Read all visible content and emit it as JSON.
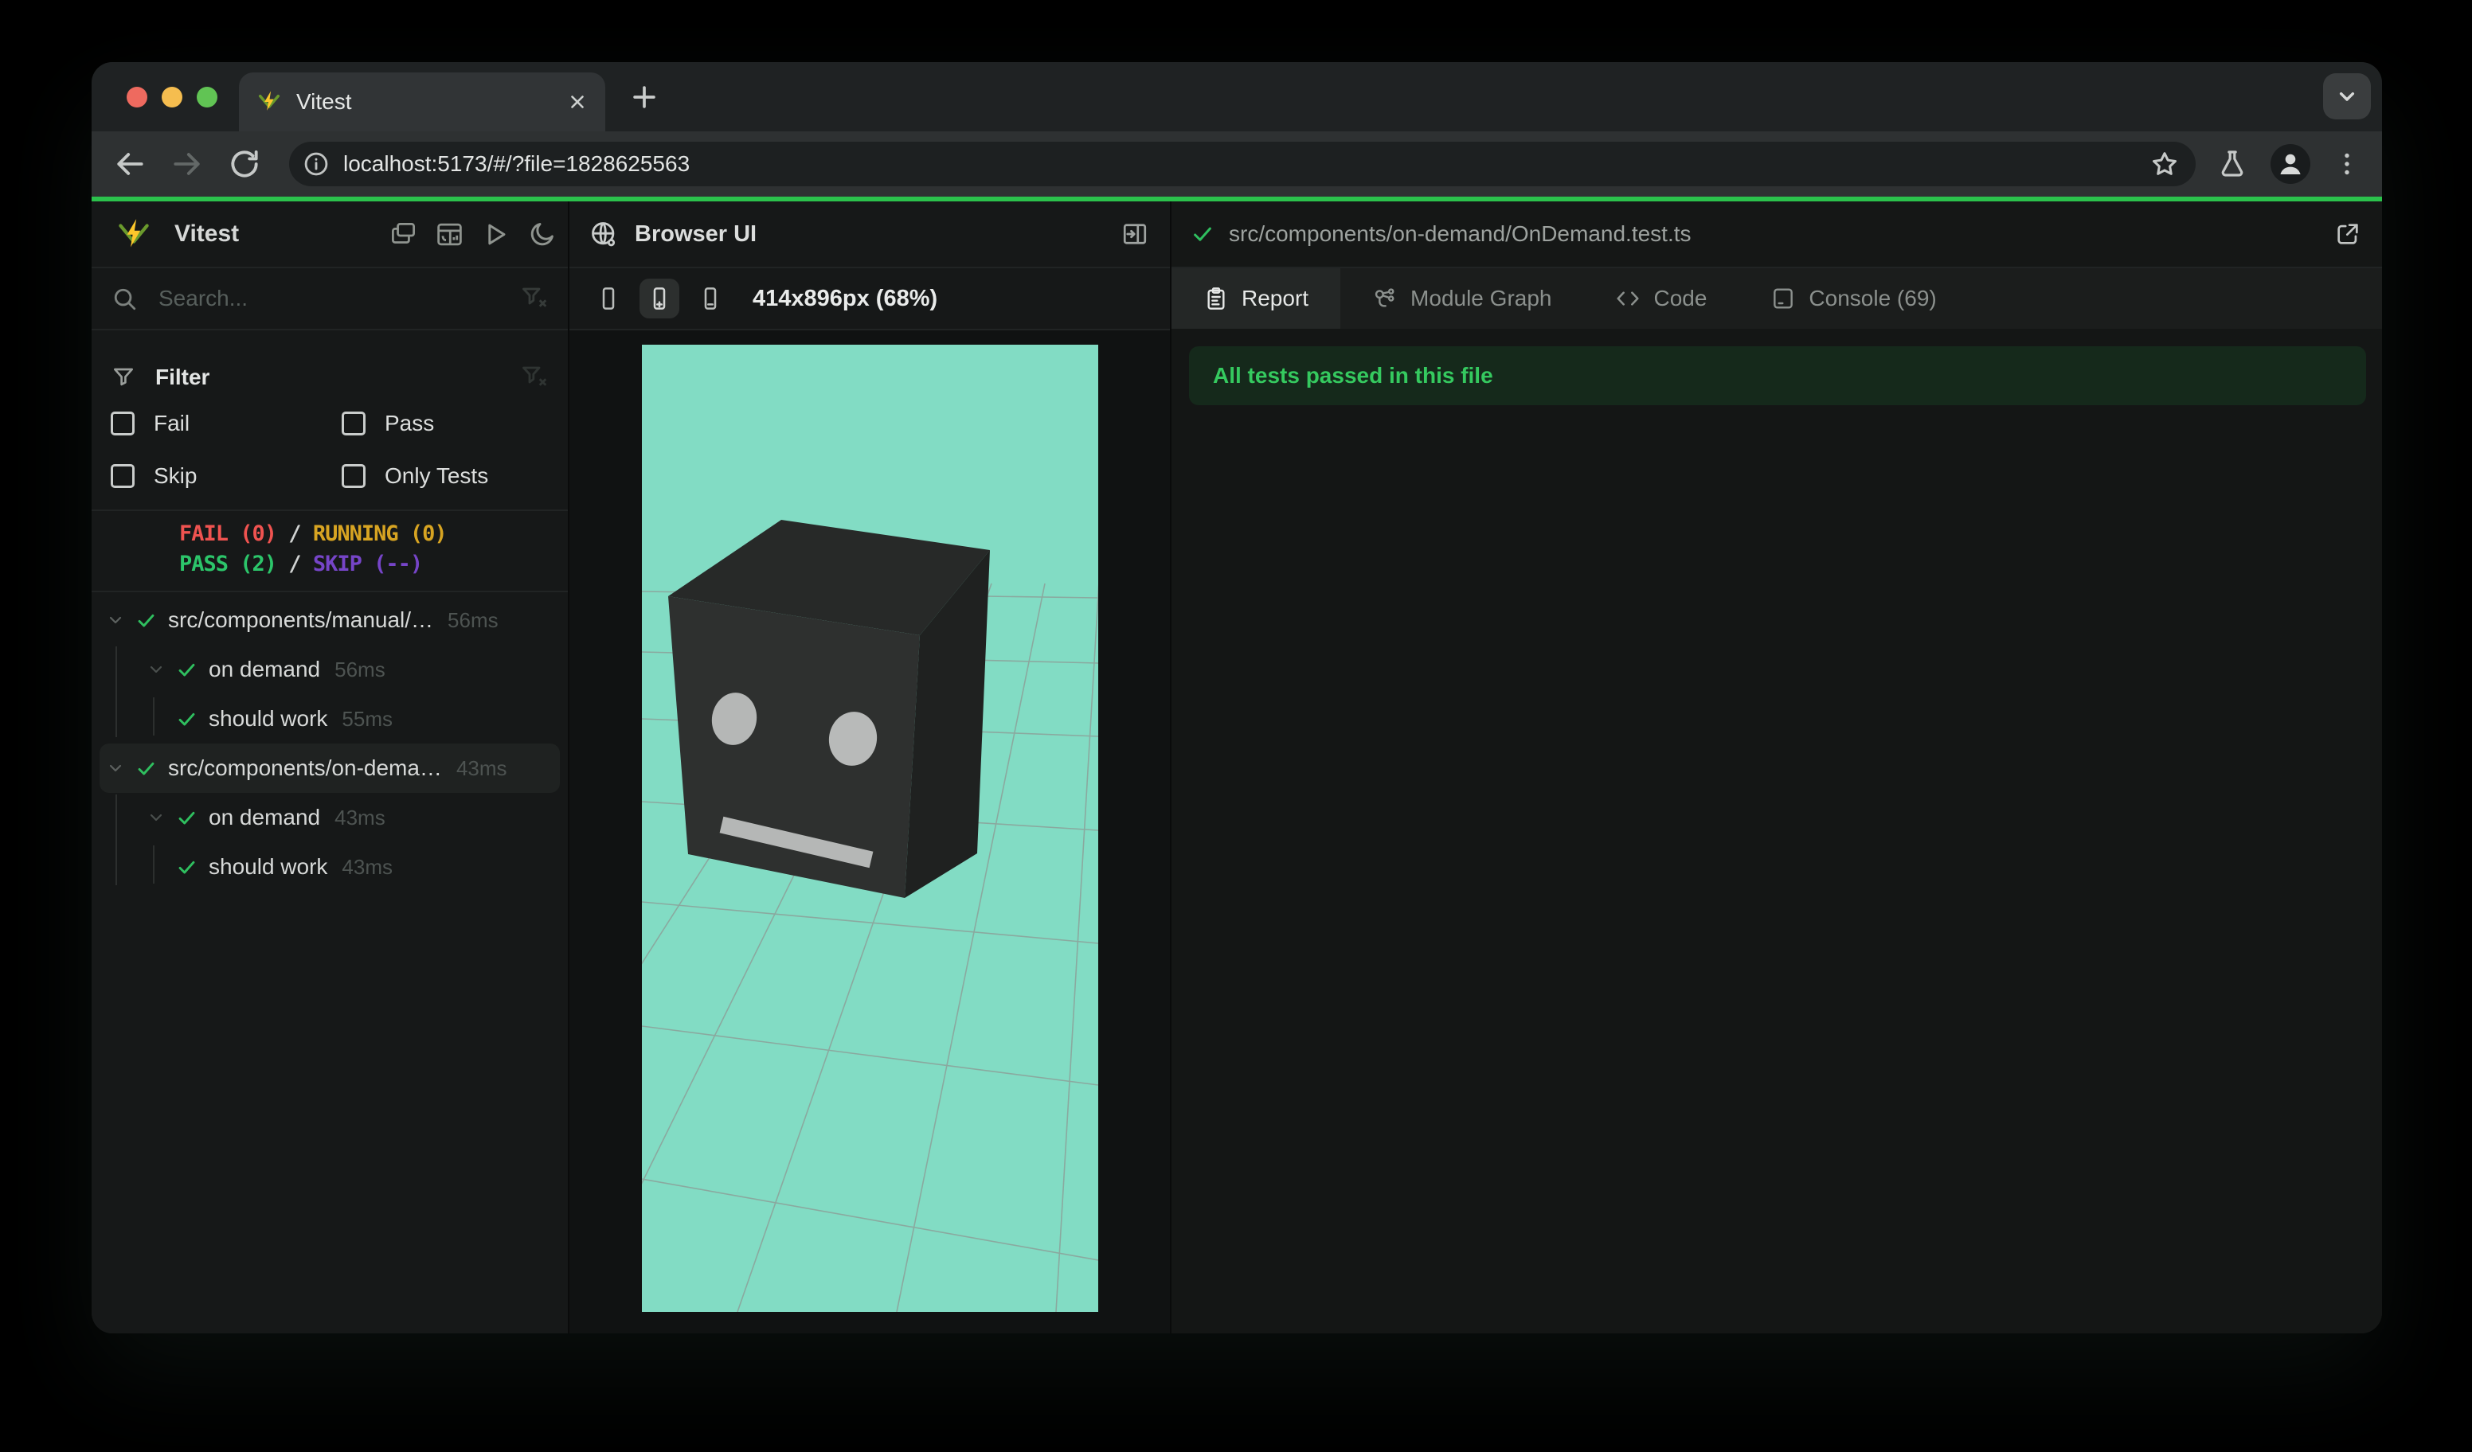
{
  "colors": {
    "accent": "#2bc24c",
    "pass_green": "#2fbf5f",
    "fail_red": "#ef5350",
    "running_yellow": "#d7a422",
    "skip_purple": "#7645c8",
    "banner_bg": "#15291b",
    "banner_text": "#35c95f",
    "viewport_teal": "#82dcc4"
  },
  "browser": {
    "tab_title": "Vitest",
    "url": "localhost:5173/#/?file=1828625563"
  },
  "sidebar": {
    "app_name": "Vitest",
    "search_placeholder": "Search...",
    "filter": {
      "title": "Filter",
      "options": [
        "Fail",
        "Pass",
        "Skip",
        "Only Tests"
      ]
    },
    "summary": {
      "fail": "FAIL (0)",
      "running": "RUNNING (0)",
      "pass": "PASS (2)",
      "skip": "SKIP (--)",
      "sep": " / "
    },
    "tree": [
      {
        "name": "src/components/manual/…",
        "time": "56ms"
      },
      {
        "name": "on demand",
        "time": "56ms"
      },
      {
        "name": "should work",
        "time": "55ms"
      },
      {
        "name": "src/components/on-dema…",
        "time": "43ms"
      },
      {
        "name": "on demand",
        "time": "43ms"
      },
      {
        "name": "should work",
        "time": "43ms"
      }
    ]
  },
  "preview": {
    "title": "Browser UI",
    "viewport_label": "414x896px (68%)"
  },
  "details": {
    "file_path": "src/components/on-demand/OnDemand.test.ts",
    "tabs": {
      "report": "Report",
      "module_graph": "Module Graph",
      "code": "Code",
      "console": "Console (69)"
    },
    "banner": "All tests passed in this file"
  }
}
